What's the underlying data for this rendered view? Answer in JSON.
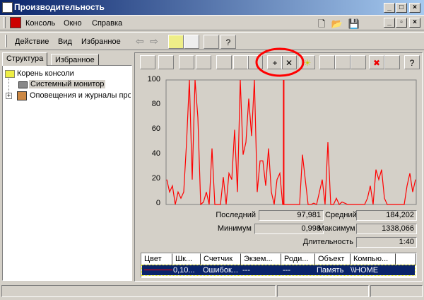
{
  "window": {
    "title": "Производительность"
  },
  "menubar": {
    "items": [
      "Консоль",
      "Окно",
      "Справка"
    ]
  },
  "actionbar": {
    "items": [
      "Действие",
      "Вид",
      "Избранное"
    ]
  },
  "left_pane": {
    "tabs": [
      "Структура",
      "Избранное"
    ],
    "tree": [
      {
        "label": "Корень консоли",
        "icon": "folder-icon"
      },
      {
        "label": "Системный монитор",
        "icon": "monitor-icon",
        "selected": true
      },
      {
        "label": "Оповещения и журналы прои",
        "icon": "alerts-icon",
        "expandable": true
      }
    ]
  },
  "graph_toolbar": {
    "icons": [
      "new-counter-set-icon",
      "clear-display-icon",
      "view-current-activity-icon",
      "view-log-data-icon",
      "view-graph-icon",
      "view-histogram-icon",
      "view-report-icon",
      "add-counter-icon",
      "delete-counter-icon",
      "highlight-icon",
      "copy-properties-icon",
      "paste-counter-list-icon",
      "properties-icon",
      "freeze-display-icon",
      "update-data-icon",
      "help-icon"
    ]
  },
  "annotation_color": "#ff0000",
  "chart_data": {
    "type": "line",
    "y_ticks": [
      "100",
      "80",
      "60",
      "40",
      "20",
      "0"
    ],
    "ylim": [
      0,
      100
    ],
    "grid": false,
    "series": [
      {
        "color": "#ff0000",
        "values": [
          20,
          10,
          15,
          0,
          10,
          5,
          10,
          50,
          100,
          20,
          100,
          70,
          0,
          2,
          10,
          0,
          45,
          0,
          0,
          0,
          22,
          0,
          25,
          20,
          60,
          10,
          100,
          40,
          50,
          85,
          55,
          100,
          10,
          35,
          35,
          15,
          45,
          10,
          0,
          20,
          25,
          0,
          0,
          0,
          0,
          0,
          0,
          0,
          40,
          20,
          0,
          0,
          1,
          0,
          10,
          20,
          0,
          50,
          0,
          0,
          5,
          0,
          2,
          1,
          0,
          0,
          0,
          0,
          0,
          0,
          0,
          5,
          15,
          0,
          28,
          20,
          28,
          5,
          0,
          0,
          0,
          0,
          0,
          0,
          0,
          15,
          25,
          10,
          20
        ]
      }
    ],
    "cursor_position": 0.47
  },
  "stats": {
    "last_label": "Последний",
    "last": "97,981",
    "avg_label": "Средний",
    "avg": "184,202",
    "min_label": "Минимум",
    "min": "0,998",
    "max_label": "Максимум",
    "max": "1338,066",
    "dur_label": "Длительность",
    "dur": "1:40"
  },
  "legend": {
    "columns": [
      "Цвет",
      "Шк...",
      "Счетчик",
      "Экзем...",
      "Роди...",
      "Объект",
      "Компью..."
    ],
    "rows": [
      {
        "color": "#ff0000",
        "scale": "0,10...",
        "counter": "Ошибок...",
        "instance": "---",
        "parent": "---",
        "object": "Память",
        "computer": "\\\\HOME"
      }
    ]
  }
}
